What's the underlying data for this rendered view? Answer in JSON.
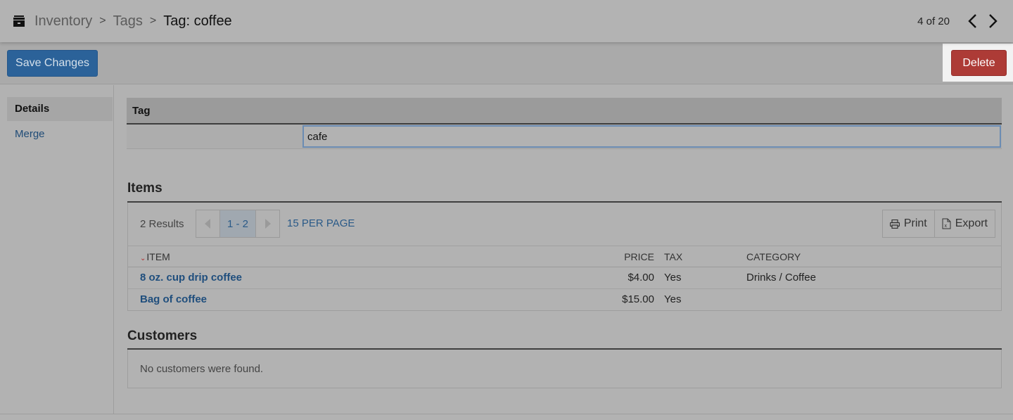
{
  "header": {
    "app_icon": "archive-box-icon",
    "breadcrumb": [
      {
        "label": "Inventory"
      },
      {
        "label": "Tags"
      }
    ],
    "current": "Tag: coffee",
    "record_position": "4 of 20",
    "prev_icon": "chevron-left-icon",
    "next_icon": "chevron-right-icon"
  },
  "toolbar": {
    "save_label": "Save Changes",
    "delete_label": "Delete"
  },
  "sidebar": {
    "items": [
      {
        "label": "Details",
        "active": true
      },
      {
        "label": "Merge",
        "active": false
      }
    ]
  },
  "tag_form": {
    "header": "Tag",
    "value": "cafe"
  },
  "items_section": {
    "title": "Items",
    "results_label": "2 Results",
    "page_range": "1 - 2",
    "per_page_label": "15 PER PAGE",
    "print_label": "Print",
    "export_label": "Export",
    "columns": {
      "item": "ITEM",
      "price": "PRICE",
      "tax": "TAX",
      "category": "CATEGORY"
    },
    "rows": [
      {
        "item": "8 oz. cup drip coffee",
        "price": "$4.00",
        "tax": "Yes",
        "category": "Drinks / Coffee"
      },
      {
        "item": "Bag of coffee",
        "price": "$15.00",
        "tax": "Yes",
        "category": ""
      }
    ]
  },
  "customers_section": {
    "title": "Customers",
    "empty_message": "No customers were found."
  },
  "colors": {
    "primary": "#2b6299",
    "danger": "#ad3b36",
    "link": "#1f4e7d"
  }
}
